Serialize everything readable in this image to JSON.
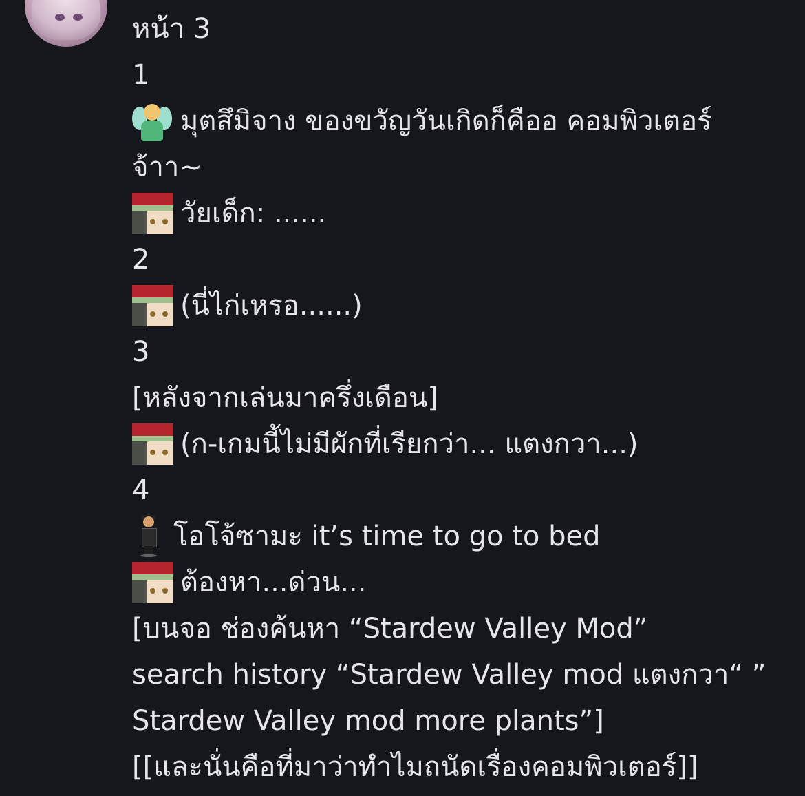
{
  "post": {
    "lines": [
      "หน้า 3",
      "1",
      "มุตสึมิจาง ของขวัญวันเกิดก็คืออ คอมพิวเตอร์",
      "จ้าา~",
      "วัยเด็ก: ......",
      "2",
      "(นี่ไก่เหรอ......)",
      "3",
      "[หลังจากเล่นมาครึ่งเดือน]",
      "(ก-เกมนี้ไม่มีผักที่เรียกว่า... แตงกวา...)",
      "4",
      "โอโจ้ซามะ it’s time to go to bed",
      "ต้องหา...ด่วน...",
      "[บนจอ ช่องค้นหา “Stardew Valley Mod”",
      "search history “Stardew Valley mod แตงกวา“ ”",
      "Stardew Valley mod more plants”]",
      "[[และนั่นคือที่มาว่าทำไมถนัดเรื่องคอมพิวเตอร์]]"
    ]
  },
  "icons": {
    "avatar": "user-avatar",
    "fairy": "fairy-emoji",
    "character": "character-emoji",
    "suit": "man-in-suit-levitating-emoji"
  }
}
